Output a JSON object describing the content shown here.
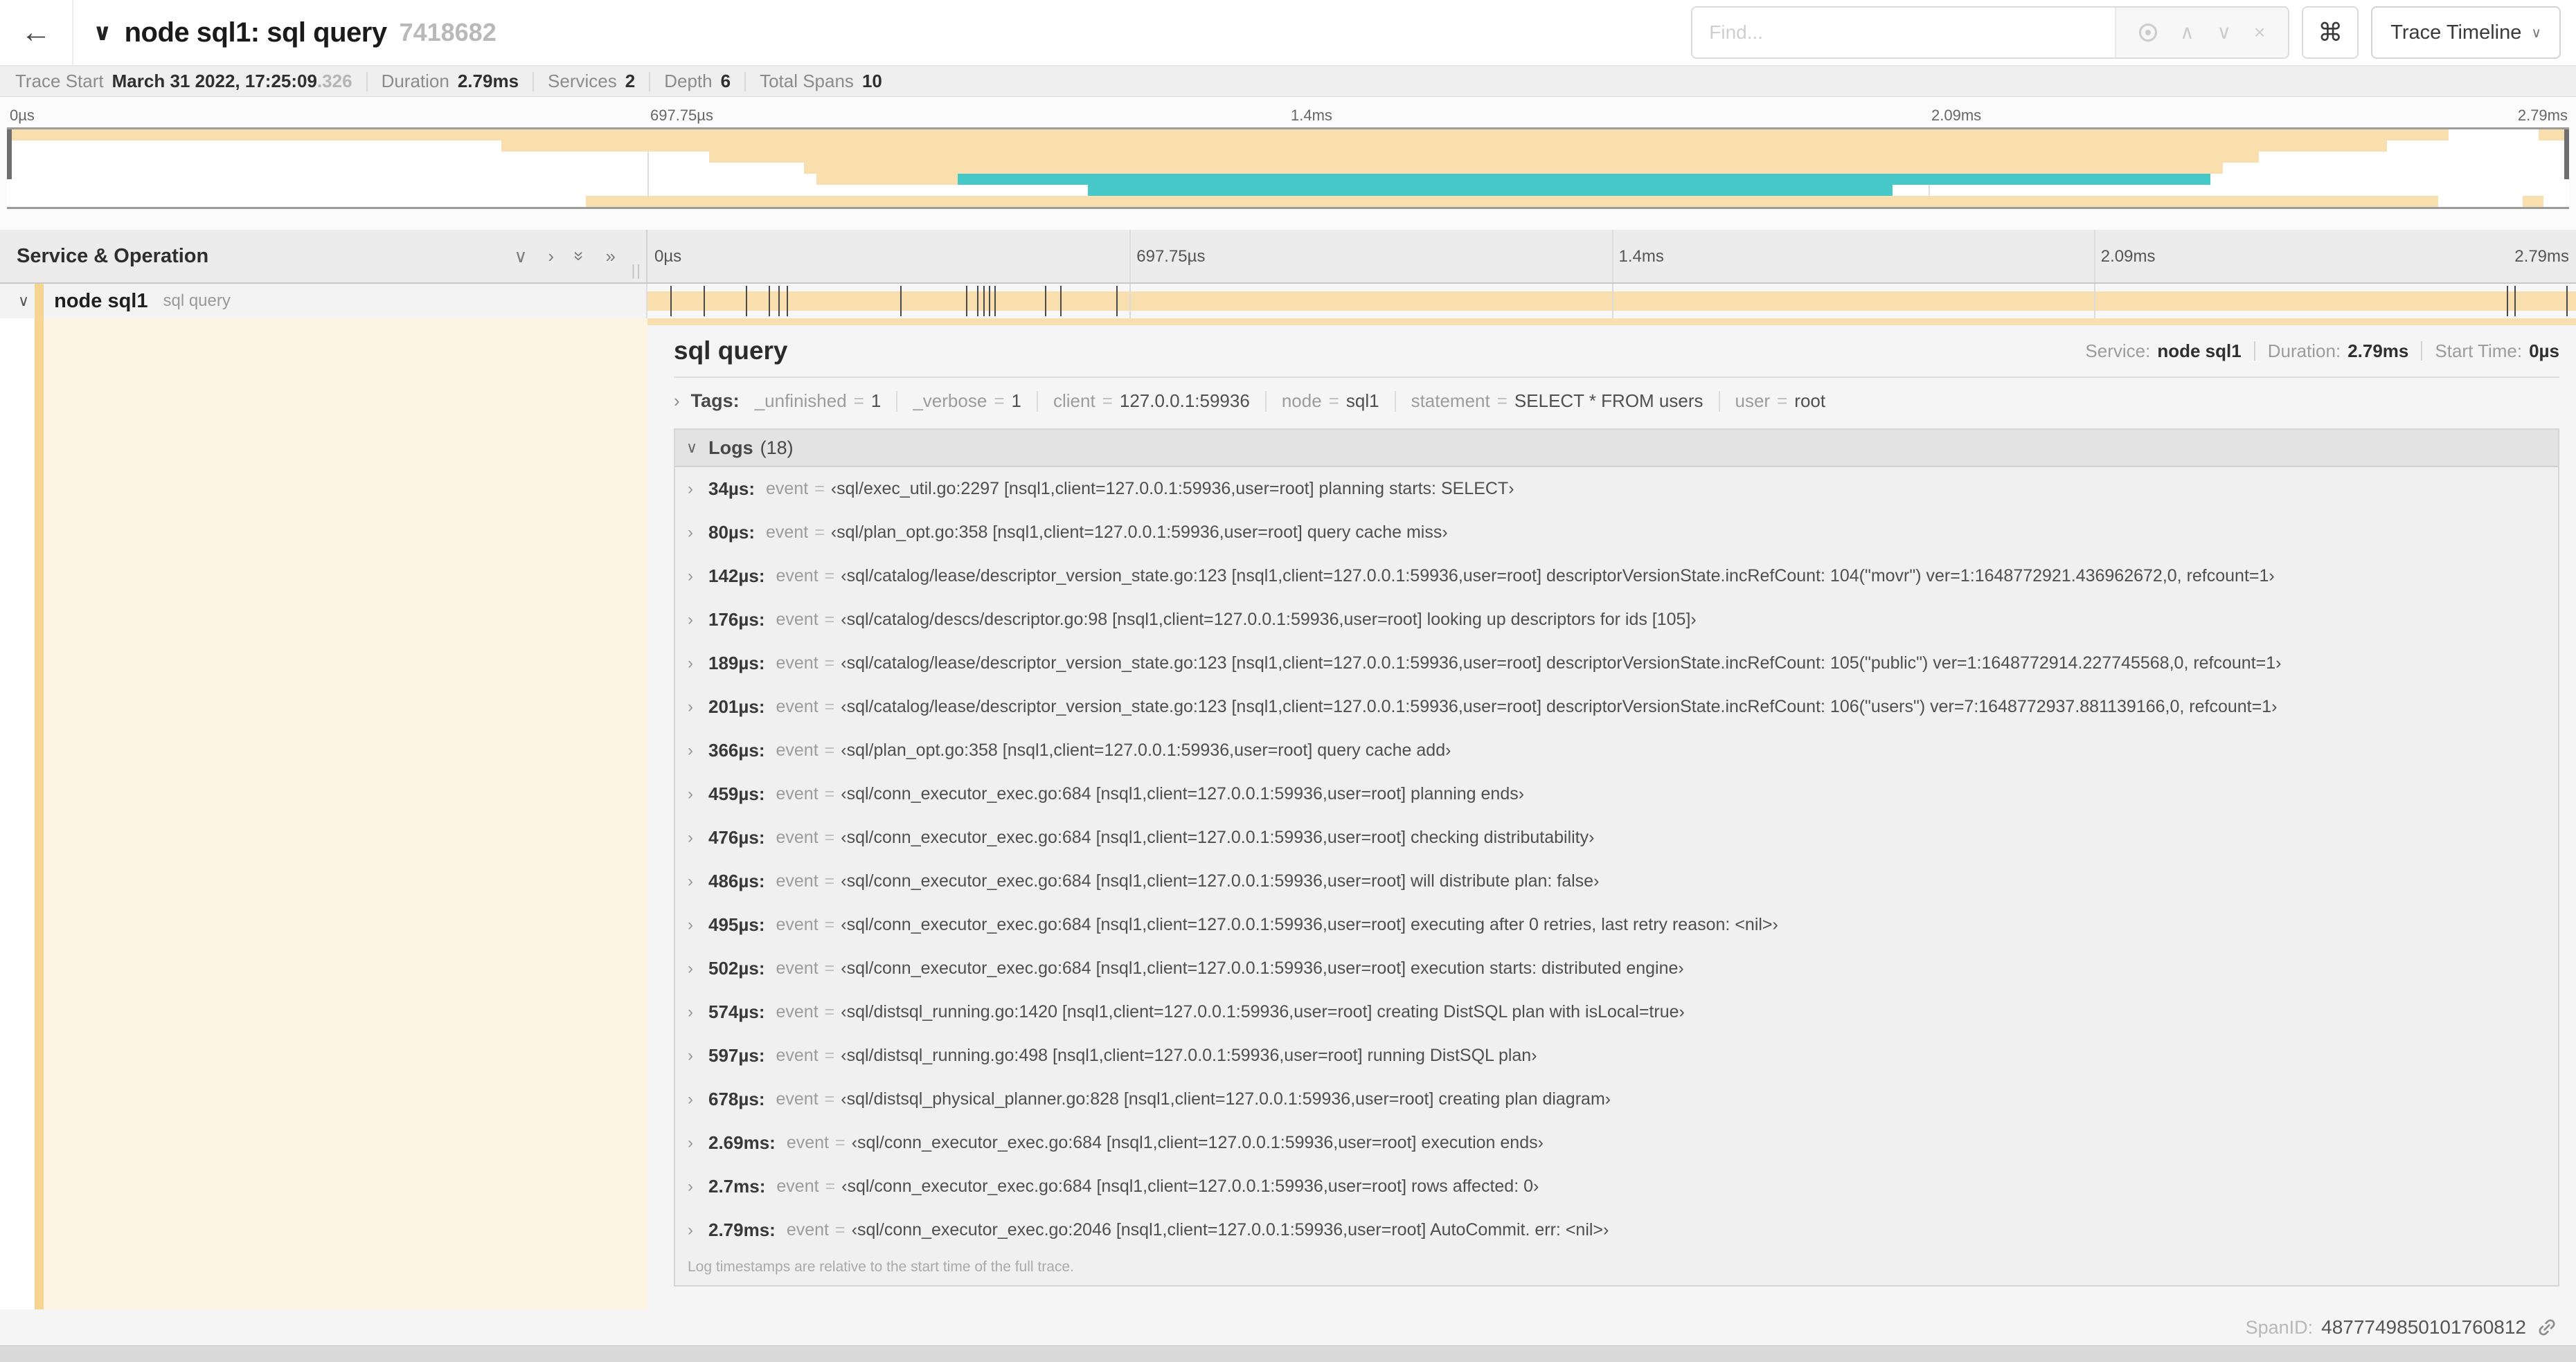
{
  "header": {
    "back_icon": "←",
    "collapse_icon": "∨",
    "title": "node sql1: sql query",
    "trace_id": "7418682",
    "find_placeholder": "Find...",
    "suffix_icons": {
      "prev": "∧",
      "next": "∨",
      "clear": "×"
    },
    "shortcut_icon": "⌘",
    "view_button": "Trace Timeline",
    "view_button_chevron": "∨"
  },
  "summary": {
    "items": [
      {
        "label": "Trace Start",
        "value": "March 31 2022, 17:25:09",
        "suffix": ".326"
      },
      {
        "label": "Duration",
        "value": "2.79ms"
      },
      {
        "label": "Services",
        "value": "2"
      },
      {
        "label": "Depth",
        "value": "6"
      },
      {
        "label": "Total Spans",
        "value": "10"
      }
    ]
  },
  "timeline": {
    "ticks": [
      "0µs",
      "697.75µs",
      "1.4ms",
      "2.09ms",
      "2.79ms"
    ],
    "tick_pcts": [
      0,
      25,
      50,
      75,
      100
    ],
    "grid_pcts": [
      25,
      50,
      75
    ],
    "header_title": "Service & Operation",
    "controls": [
      {
        "name": "collapse-one",
        "glyph": "∨",
        "rot": false
      },
      {
        "name": "expand-one",
        "glyph": "›",
        "rot": false
      },
      {
        "name": "collapse-all",
        "glyph": "»",
        "rot": true
      },
      {
        "name": "expand-all",
        "glyph": "»",
        "rot": false
      }
    ],
    "resizer_glyph": "||"
  },
  "minimap": {
    "colors": {
      "tan": "#F8DFAD",
      "teal": "#47C8C8"
    },
    "rows": 7,
    "bars": [
      {
        "row": 0,
        "s": 0,
        "e": 95.3,
        "c": "tan"
      },
      {
        "row": 0,
        "s": 98.8,
        "e": 100,
        "c": "tan"
      },
      {
        "row": 1,
        "s": 19.3,
        "e": 92.9,
        "c": "tan"
      },
      {
        "row": 2,
        "s": 27.4,
        "e": 87.9,
        "c": "tan"
      },
      {
        "row": 3,
        "s": 31.1,
        "e": 86.5,
        "c": "tan"
      },
      {
        "row": 4,
        "s": 31.6,
        "e": 37.1,
        "c": "tan"
      },
      {
        "row": 4,
        "s": 37.1,
        "e": 86.0,
        "c": "teal"
      },
      {
        "row": 5,
        "s": 42.2,
        "e": 73.6,
        "c": "teal"
      },
      {
        "row": 6,
        "s": 22.6,
        "e": 94.9,
        "c": "tan"
      },
      {
        "row": 6,
        "s": 98.2,
        "e": 99.0,
        "c": "tan"
      }
    ]
  },
  "span_row": {
    "chevron": "∨",
    "service": "node sql1",
    "operation": "sql query",
    "log_marks_pct": [
      1.2,
      2.9,
      5.1,
      6.3,
      6.8,
      7.2,
      13.1,
      16.5,
      17.1,
      17.4,
      17.7,
      18.0,
      20.6,
      21.4,
      24.3,
      96.4,
      96.8,
      99.5
    ]
  },
  "detail": {
    "title": "sql query",
    "service_label": "Service:",
    "service": "node sql1",
    "duration_label": "Duration:",
    "duration": "2.79ms",
    "start_label": "Start Time:",
    "start": "0µs",
    "tags_chevron": "›",
    "tags_label": "Tags:",
    "tags": [
      {
        "key": "_unfinished",
        "value": "1"
      },
      {
        "key": "_verbose",
        "value": "1"
      },
      {
        "key": "client",
        "value": "127.0.0.1:59936"
      },
      {
        "key": "node",
        "value": "sql1"
      },
      {
        "key": "statement",
        "value": "SELECT * FROM users"
      },
      {
        "key": "user",
        "value": "root"
      }
    ],
    "logs_chevron": "∨",
    "logs_label": "Logs",
    "logs_count": "(18)",
    "log_row_chevron": "›",
    "logs": [
      {
        "t": "34µs:",
        "key": "event",
        "value": "‹sql/exec_util.go:2297 [nsql1,client=127.0.0.1:59936,user=root] planning starts: SELECT›"
      },
      {
        "t": "80µs:",
        "key": "event",
        "value": "‹sql/plan_opt.go:358 [nsql1,client=127.0.0.1:59936,user=root] query cache miss›"
      },
      {
        "t": "142µs:",
        "key": "event",
        "value": "‹sql/catalog/lease/descriptor_version_state.go:123 [nsql1,client=127.0.0.1:59936,user=root] descriptorVersionState.incRefCount: 104(\"movr\") ver=1:1648772921.436962672,0, refcount=1›"
      },
      {
        "t": "176µs:",
        "key": "event",
        "value": "‹sql/catalog/descs/descriptor.go:98 [nsql1,client=127.0.0.1:59936,user=root] looking up descriptors for ids [105]›"
      },
      {
        "t": "189µs:",
        "key": "event",
        "value": "‹sql/catalog/lease/descriptor_version_state.go:123 [nsql1,client=127.0.0.1:59936,user=root] descriptorVersionState.incRefCount: 105(\"public\") ver=1:1648772914.227745568,0, refcount=1›"
      },
      {
        "t": "201µs:",
        "key": "event",
        "value": "‹sql/catalog/lease/descriptor_version_state.go:123 [nsql1,client=127.0.0.1:59936,user=root] descriptorVersionState.incRefCount: 106(\"users\") ver=7:1648772937.881139166,0, refcount=1›"
      },
      {
        "t": "366µs:",
        "key": "event",
        "value": "‹sql/plan_opt.go:358 [nsql1,client=127.0.0.1:59936,user=root] query cache add›"
      },
      {
        "t": "459µs:",
        "key": "event",
        "value": "‹sql/conn_executor_exec.go:684 [nsql1,client=127.0.0.1:59936,user=root] planning ends›"
      },
      {
        "t": "476µs:",
        "key": "event",
        "value": "‹sql/conn_executor_exec.go:684 [nsql1,client=127.0.0.1:59936,user=root] checking distributability›"
      },
      {
        "t": "486µs:",
        "key": "event",
        "value": "‹sql/conn_executor_exec.go:684 [nsql1,client=127.0.0.1:59936,user=root] will distribute plan: false›"
      },
      {
        "t": "495µs:",
        "key": "event",
        "value": "‹sql/conn_executor_exec.go:684 [nsql1,client=127.0.0.1:59936,user=root] executing after 0 retries, last retry reason: <nil>›"
      },
      {
        "t": "502µs:",
        "key": "event",
        "value": "‹sql/conn_executor_exec.go:684 [nsql1,client=127.0.0.1:59936,user=root] execution starts: distributed engine›"
      },
      {
        "t": "574µs:",
        "key": "event",
        "value": "‹sql/distsql_running.go:1420 [nsql1,client=127.0.0.1:59936,user=root] creating DistSQL plan with isLocal=true›"
      },
      {
        "t": "597µs:",
        "key": "event",
        "value": "‹sql/distsql_running.go:498 [nsql1,client=127.0.0.1:59936,user=root] running DistSQL plan›"
      },
      {
        "t": "678µs:",
        "key": "event",
        "value": "‹sql/distsql_physical_planner.go:828 [nsql1,client=127.0.0.1:59936,user=root] creating plan diagram›"
      },
      {
        "t": "2.69ms:",
        "key": "event",
        "value": "‹sql/conn_executor_exec.go:684 [nsql1,client=127.0.0.1:59936,user=root] execution ends›"
      },
      {
        "t": "2.7ms:",
        "key": "event",
        "value": "‹sql/conn_executor_exec.go:684 [nsql1,client=127.0.0.1:59936,user=root] rows affected: 0›"
      },
      {
        "t": "2.79ms:",
        "key": "event",
        "value": "‹sql/conn_executor_exec.go:2046 [nsql1,client=127.0.0.1:59936,user=root] AutoCommit. err: <nil>›"
      }
    ],
    "logs_note": "Log timestamps are relative to the start time of the full trace.",
    "spanid_label": "SpanID:",
    "spanid": "4877749850101760812"
  }
}
